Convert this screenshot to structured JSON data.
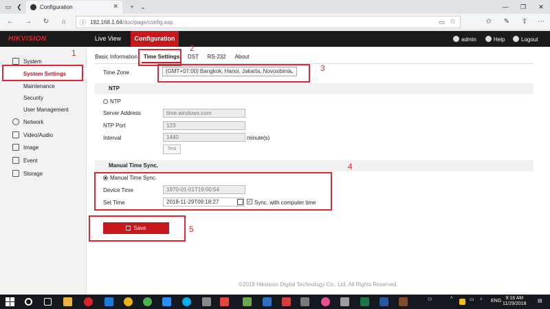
{
  "browser": {
    "tab_title": "Configuration",
    "url_host": "192.168.1.64",
    "url_path": "/doc/page/config.asp"
  },
  "header": {
    "logo": "HIKVISION",
    "nav": [
      "Live View",
      "Configuration"
    ],
    "user": "admin",
    "help": "Help",
    "logout": "Logout"
  },
  "sidebar": {
    "items": [
      "System",
      "System Settings",
      "Maintenance",
      "Security",
      "User Management",
      "Network",
      "Video/Audio",
      "Image",
      "Event",
      "Storage"
    ]
  },
  "subtabs": [
    "Basic Information",
    "Time Settings",
    "DST",
    "RS-232",
    "About"
  ],
  "form": {
    "time_zone_label": "Time Zone",
    "time_zone_value": "(GMT+07:00) Bangkok, Hanoi, Jakarta, Novosibirsk",
    "ntp_section": "NTP",
    "ntp_radio": "NTP",
    "server_address_label": "Server Address",
    "server_address_value": "time.windows.com",
    "ntp_port_label": "NTP Port",
    "ntp_port_value": "123",
    "interval_label": "Interval",
    "interval_value": "1440",
    "interval_unit": "minute(s)",
    "test_button": "Test",
    "manual_section": "Manual Time Sync.",
    "manual_radio": "Manual Time Sync.",
    "device_time_label": "Device Time",
    "device_time_value": "1970-01-01T19:00:54",
    "set_time_label": "Set Time",
    "set_time_value": "2018-11-29T09:18:27",
    "sync_label": "Sync. with computer time",
    "save_button": "Save"
  },
  "footer": "©2018 Hikvision Digital Technology Co., Ltd. All Rights Reserved.",
  "annotations": [
    "1",
    "2",
    "3",
    "4",
    "5"
  ],
  "taskbar": {
    "lang": "ENG",
    "time": "9:18 AM",
    "date": "11/29/2018"
  },
  "colors": {
    "accent": "#c8161d",
    "header_bg": "#1b1b1b",
    "annotation": "#e0262c"
  }
}
